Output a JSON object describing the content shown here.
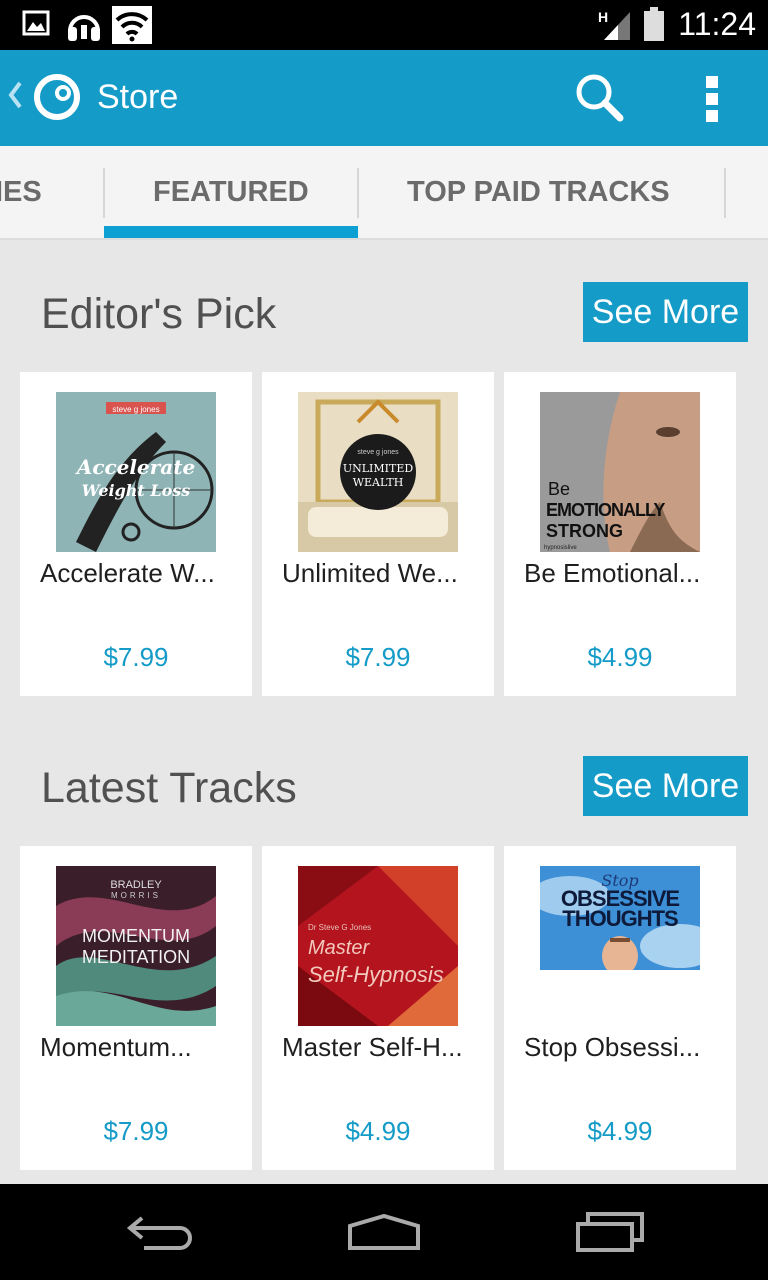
{
  "status_bar": {
    "time": "11:24",
    "icons": [
      "gallery-icon",
      "headphones-icon",
      "wifi-icon",
      "signal-icon",
      "battery-icon"
    ]
  },
  "action_bar": {
    "title": "Store",
    "icons": [
      "back-icon",
      "app-logo-icon",
      "search-icon",
      "overflow-menu-icon"
    ],
    "color": "#149bc7"
  },
  "tabs": [
    {
      "label": "RIES",
      "selected": false
    },
    {
      "label": "FEATURED",
      "selected": true
    },
    {
      "label": "TOP PAID TRACKS",
      "selected": false
    }
  ],
  "sections": [
    {
      "title": "Editor's Pick",
      "see_more": "See More",
      "items": [
        {
          "name": "Accelerate W...",
          "price": "$7.99",
          "art_title": "Accelerate Weight Loss",
          "art_author": "steve g jones"
        },
        {
          "name": "Unlimited We...",
          "price": "$7.99",
          "art_title_line1": "UNLIMITED",
          "art_title_line2": "WEALTH",
          "art_author": "steve g jones"
        },
        {
          "name": "Be Emotional...",
          "price": "$4.99",
          "art_be": "Be",
          "art_line1": "EMOTIONALLY",
          "art_line2": "STRONG",
          "art_brand": "hypnosislive"
        }
      ]
    },
    {
      "title": "Latest Tracks",
      "see_more": "See More",
      "items": [
        {
          "name": "Momentum...",
          "price": "$7.99",
          "art_author1": "BRADLEY",
          "art_author2": "MORRIS",
          "art_line1": "MOMENTUM",
          "art_line2": "MEDITATION"
        },
        {
          "name": "Master Self-H...",
          "price": "$4.99",
          "art_author": "Dr Steve G Jones",
          "art_line1": "Master",
          "art_line2": "Self-Hypnosis"
        },
        {
          "name": "Stop Obsessi...",
          "price": "$4.99",
          "art_stop": "Stop",
          "art_line1": "OBSESSIVE",
          "art_line2": "THOUGHTS"
        }
      ]
    }
  ],
  "nav_bar": {
    "icons": [
      "back-nav-icon",
      "home-nav-icon",
      "recents-nav-icon"
    ]
  }
}
